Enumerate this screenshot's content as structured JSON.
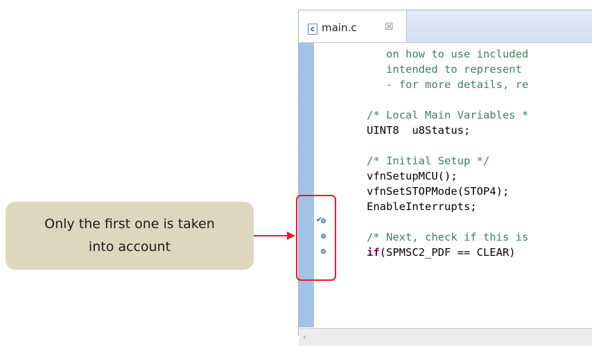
{
  "callout": {
    "text": "Only the first one is taken\ninto account"
  },
  "editor": {
    "tab": {
      "icon": "c-source-file-icon",
      "icon_glyph": "c",
      "label": "main.c",
      "close_glyph": "☒"
    },
    "lines": [
      {
        "text": "   on how to use included",
        "style": "cmt"
      },
      {
        "text": "   intended to represent ",
        "style": "cmt"
      },
      {
        "text": "   - for more details, re",
        "style": "cmt"
      },
      {
        "text": "",
        "style": "plain"
      },
      {
        "text": "/* Local Main Variables *",
        "style": "cmt"
      },
      {
        "text": "UINT8  u8Status;",
        "style": "plain"
      },
      {
        "text": "",
        "style": "plain"
      },
      {
        "text": "/* Initial Setup */",
        "style": "cmt"
      },
      {
        "text": "vfnSetupMCU();",
        "style": "plain"
      },
      {
        "text": "vfnSetSTOPMode(STOP4);",
        "style": "plain"
      },
      {
        "text": "EnableInterrupts;",
        "style": "plain"
      },
      {
        "text": "",
        "style": "plain"
      },
      {
        "text": "/* Next, check if this is",
        "style": "cmt"
      },
      {
        "kw": "if",
        "rest": "(SPMSC2_PDF == CLEAR)",
        "style": "kwline"
      }
    ],
    "breakpoints": [
      {
        "name": "breakpoint-1",
        "checked": true
      },
      {
        "name": "breakpoint-2",
        "checked": false
      },
      {
        "name": "breakpoint-3",
        "checked": false
      }
    ],
    "scroll_left_glyph": "‹"
  },
  "colors": {
    "highlight": "#e8192c",
    "arrow": "#e8192c",
    "callout_bg": "#dcd8bd",
    "comment": "#3f7f5f",
    "keyword": "#7f0055"
  }
}
